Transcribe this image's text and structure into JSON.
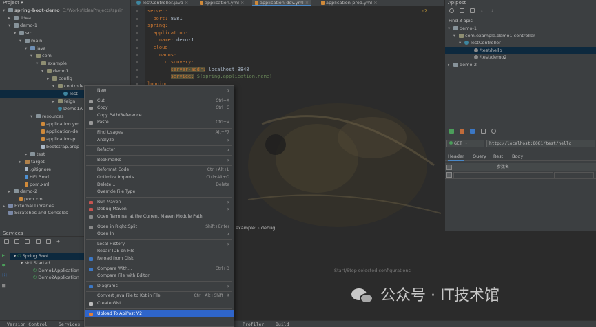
{
  "project": {
    "panel_title": "Project",
    "tree": [
      {
        "label": "spring-boot-demo",
        "path": "E:\\Works\\IdeaProjects\\sprin",
        "icon": "folder"
      },
      {
        "label": ".idea",
        "icon": "folder"
      },
      {
        "label": "demo-1",
        "icon": "folder"
      },
      {
        "label": "src",
        "icon": "folder"
      },
      {
        "label": "main",
        "icon": "folder"
      },
      {
        "label": "java",
        "icon": "folder-src"
      },
      {
        "label": "com",
        "icon": "package"
      },
      {
        "label": "example",
        "icon": "package"
      },
      {
        "label": "demo1",
        "icon": "package"
      },
      {
        "label": "config",
        "icon": "package"
      },
      {
        "label": "controller",
        "icon": "package"
      },
      {
        "label": "Test",
        "icon": "class"
      },
      {
        "label": "feign",
        "icon": "package"
      },
      {
        "label": "Demo1A",
        "icon": "class"
      },
      {
        "label": "resources",
        "icon": "folder"
      },
      {
        "label": "application.ym",
        "icon": "yml"
      },
      {
        "label": "application-de",
        "icon": "yml"
      },
      {
        "label": "application-pr",
        "icon": "yml"
      },
      {
        "label": "bootstrap.prop",
        "icon": "file"
      },
      {
        "label": "test",
        "icon": "folder"
      },
      {
        "label": "target",
        "icon": "folder-orange"
      },
      {
        "label": ".gitignore",
        "icon": "file"
      },
      {
        "label": "HELP.md",
        "icon": "md"
      },
      {
        "label": "pom.xml",
        "icon": "xml"
      },
      {
        "label": "demo-2",
        "icon": "folder"
      },
      {
        "label": "pom.xml",
        "icon": "xml"
      },
      {
        "label": "External Libraries",
        "icon": "library"
      },
      {
        "label": "Scratches and Consoles",
        "icon": "scratch"
      }
    ]
  },
  "editor": {
    "tabs": [
      "TestController.java",
      "application.yml",
      "application-dev.yml",
      "application-prod.yml"
    ],
    "warning_count": "2",
    "code_lines": [
      {
        "indent": "",
        "key": "server:",
        "val": ""
      },
      {
        "indent": "  ",
        "key": "port:",
        "val": " 8081"
      },
      {
        "indent": "",
        "key": "spring:",
        "val": ""
      },
      {
        "indent": "  ",
        "key": "application:",
        "val": ""
      },
      {
        "indent": "    ",
        "key": "name:",
        "val": " demo-1"
      },
      {
        "indent": "  ",
        "key": "cloud:",
        "val": ""
      },
      {
        "indent": "    ",
        "key": "nacos:",
        "val": ""
      },
      {
        "indent": "      ",
        "key": "discovery:",
        "val": ""
      },
      {
        "indent": "        ",
        "key": "server-addr:",
        "val": " localhost:8848"
      },
      {
        "indent": "        ",
        "key": "service:",
        "val": " ${spring.application.name}"
      },
      {
        "indent": "",
        "key": "logging:",
        "val": ""
      }
    ],
    "breadcrumb": [
      "example:",
      "debug"
    ]
  },
  "apipost": {
    "title": "Apipost",
    "found": "Find 3 apis",
    "tree": [
      "demo-1",
      "com.example.demo1.controller",
      "TestController",
      "/test/hello",
      "/test/demo2",
      "demo-2"
    ],
    "method": "GET",
    "url": "http://localhost:8081/test/hello",
    "tabs": [
      "Header",
      "Query",
      "Rest",
      "Body"
    ],
    "param_header": "参数名"
  },
  "services": {
    "title": "Services",
    "root": "Spring Boot",
    "group": "Not Started",
    "apps": [
      "Demo1Application",
      "Demo2Application"
    ],
    "hint": "Start/Stop selected configurations"
  },
  "statusbar": [
    "Version Control",
    "Services",
    "Profiler",
    "Build"
  ],
  "context_menu": [
    {
      "label": "New",
      "shortcut": "",
      "sub": true
    },
    {
      "sep": true
    },
    {
      "label": "Cut",
      "shortcut": "Ctrl+X",
      "icon": "cut-icon"
    },
    {
      "label": "Copy",
      "shortcut": "Ctrl+C",
      "icon": "copy-icon"
    },
    {
      "label": "Copy Path/Reference…",
      "shortcut": ""
    },
    {
      "label": "Paste",
      "shortcut": "Ctrl+V",
      "icon": "paste-icon"
    },
    {
      "sep": true
    },
    {
      "label": "Find Usages",
      "shortcut": "Alt+F7"
    },
    {
      "label": "Analyze",
      "shortcut": "",
      "sub": true
    },
    {
      "sep": true
    },
    {
      "label": "Refactor",
      "shortcut": "",
      "sub": true
    },
    {
      "sep": true
    },
    {
      "label": "Bookmarks",
      "shortcut": "",
      "sub": true
    },
    {
      "sep": true
    },
    {
      "label": "Reformat Code",
      "shortcut": "Ctrl+Alt+L"
    },
    {
      "label": "Optimize Imports",
      "shortcut": "Ctrl+Alt+O"
    },
    {
      "label": "Delete…",
      "shortcut": "Delete"
    },
    {
      "label": "Override File Type",
      "shortcut": ""
    },
    {
      "sep": true
    },
    {
      "label": "Run Maven",
      "shortcut": "",
      "sub": true,
      "icon": "maven-icon"
    },
    {
      "label": "Debug Maven",
      "shortcut": "",
      "sub": true,
      "icon": "maven-icon"
    },
    {
      "label": "Open Terminal at the Current Maven Module Path",
      "shortcut": "",
      "icon": "terminal-icon"
    },
    {
      "sep": true
    },
    {
      "label": "Open in Right Split",
      "shortcut": "Shift+Enter",
      "icon": "split-icon"
    },
    {
      "label": "Open In",
      "shortcut": "",
      "sub": true
    },
    {
      "sep": true
    },
    {
      "label": "Local History",
      "shortcut": "",
      "sub": true
    },
    {
      "label": "Repair IDE on File",
      "shortcut": ""
    },
    {
      "label": "Reload from Disk",
      "shortcut": "",
      "icon": "reload-icon"
    },
    {
      "sep": true
    },
    {
      "label": "Compare With…",
      "shortcut": "Ctrl+D",
      "icon": "compare-icon"
    },
    {
      "label": "Compare File with Editor",
      "shortcut": ""
    },
    {
      "sep": true
    },
    {
      "label": "Diagrams",
      "shortcut": "",
      "sub": true,
      "icon": "diagram-icon"
    },
    {
      "sep": true
    },
    {
      "label": "Convert Java File to Kotlin File",
      "shortcut": "Ctrl+Alt+Shift+K"
    },
    {
      "label": "Create Gist…",
      "shortcut": "",
      "icon": "github-icon"
    },
    {
      "sep": true
    },
    {
      "label": "Upload To ApiPost V2",
      "shortcut": "",
      "icon": "apipost-icon",
      "highlight": true
    }
  ],
  "watermark": "公众号 · IT技术馆",
  "colors": {
    "accent": "#2f65ca",
    "selection": "#0d293e",
    "yaml_key": "#cc7832",
    "yaml_value": "#6a8759"
  }
}
